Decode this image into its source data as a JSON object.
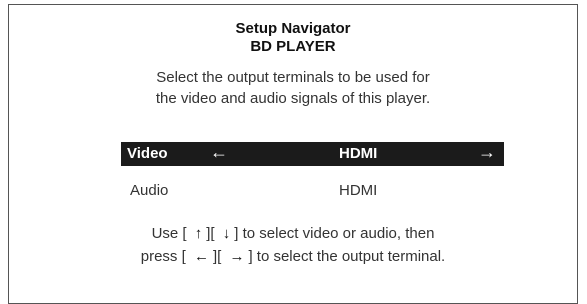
{
  "dialog": {
    "title": "Setup Navigator",
    "subtitle": "BD PLAYER",
    "description_line1": "Select the output terminals to be used for",
    "description_line2": "the video and audio signals of this player."
  },
  "rows": {
    "video": {
      "label": "Video",
      "value": "HDMI",
      "left_arrow": "←",
      "right_arrow": "→"
    },
    "audio": {
      "label": "Audio",
      "value": "HDMI"
    }
  },
  "help": {
    "line1_prefix": "Use [",
    "up_key": "↑",
    "line1_mid": "][",
    "down_key": "↓",
    "line1_suffix": "] to select video or audio, then",
    "line2_prefix": "press [",
    "left_key": "←",
    "line2_mid": "][",
    "right_key": "→",
    "line2_suffix": "] to select the output terminal."
  },
  "colors": {
    "highlight_bg": "#1b1b1b",
    "highlight_text": "#ffffff"
  }
}
